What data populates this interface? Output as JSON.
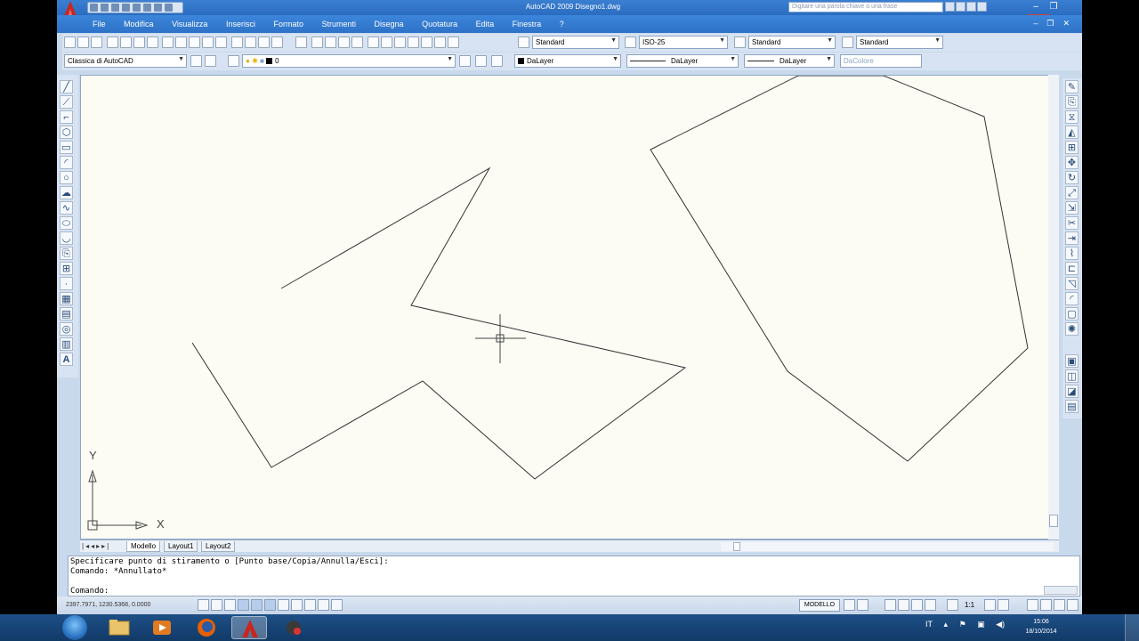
{
  "window": {
    "title": "AutoCAD 2009 Disegno1.dwg",
    "search_placeholder": "Digitare una parola chiave o una frase",
    "minimize": "–",
    "maximize": "❐",
    "close": "✕"
  },
  "menu": {
    "items": [
      "File",
      "Modifica",
      "Visualizza",
      "Inserisci",
      "Formato",
      "Strumenti",
      "Disegna",
      "Quotatura",
      "Edita",
      "Finestra",
      "?"
    ],
    "doc_min": "–",
    "doc_max": "❐",
    "doc_close": "✕"
  },
  "toolbar_styles": {
    "text_style": "Standard",
    "dim_style": "ISO-25",
    "table_style": "Standard",
    "multileader_style": "Standard"
  },
  "toolbar_layers": {
    "workspace": "Classica di AutoCAD",
    "layer": "0",
    "color": "DaLayer",
    "linetype": "DaLayer",
    "lineweight": "DaLayer",
    "plotstyle": "DaColore"
  },
  "canvas": {
    "ucs_x": "X",
    "ucs_y": "Y"
  },
  "tabs": {
    "items": [
      "Modello",
      "Layout1",
      "Layout2"
    ]
  },
  "command": {
    "history": [
      "Specificare punto di stiramento o [Punto base/Copia/Annulla/Esci]:",
      "Comando: *Annullato*"
    ],
    "prompt": "Comando:"
  },
  "status": {
    "coords": "2397.7971, 1230.5368, 0.0000",
    "model": "MODELLO",
    "scale": "1:1"
  },
  "taskbar": {
    "lang": "IT",
    "time": "15:06",
    "date": "18/10/2014"
  },
  "colors": {
    "canvas_bg": "#fcfcf5",
    "title_blue": "#2e73c8",
    "toolbar_bg": "#d7e3f2",
    "autocad_red": "#c8261e"
  }
}
